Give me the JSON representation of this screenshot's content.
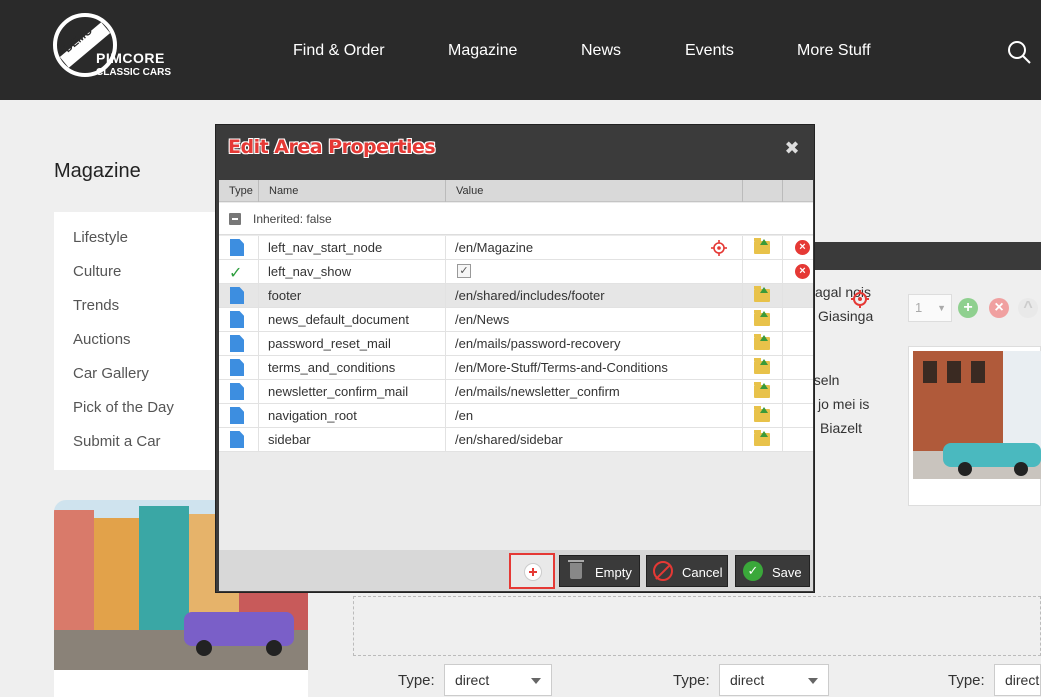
{
  "nav": {
    "logo_demo": "DEMO",
    "logo_brand": "PIMCORE",
    "logo_sub": "CLASSIC CARS",
    "items": [
      "Find & Order",
      "Magazine",
      "News",
      "Events",
      "More Stuff"
    ]
  },
  "page": {
    "title": "Magazine",
    "sidebar": [
      "Lifestyle",
      "Culture",
      "Trends",
      "Auctions",
      "Car Gallery",
      "Pick of the Day",
      "Submit a Car"
    ],
    "bg_text": [
      "agal nois",
      "Giasinga",
      "eseln",
      "jo mei is",
      "Biazelt"
    ],
    "select_value": "1",
    "type_label": "Type:",
    "type_value": "direct"
  },
  "dialog": {
    "title": "Edit Area Properties",
    "columns": {
      "type": "Type",
      "name": "Name",
      "value": "Value"
    },
    "group_label": "Inherited: false",
    "rows": [
      {
        "name": "left_nav_start_node",
        "value": "/en/Magazine"
      },
      {
        "name": "left_nav_show",
        "value": ""
      },
      {
        "name": "footer",
        "value": "/en/shared/includes/footer"
      },
      {
        "name": "news_default_document",
        "value": "/en/News"
      },
      {
        "name": "password_reset_mail",
        "value": "/en/mails/password-recovery"
      },
      {
        "name": "terms_and_conditions",
        "value": "/en/More-Stuff/Terms-and-Conditions"
      },
      {
        "name": "newsletter_confirm_mail",
        "value": "/en/mails/newsletter_confirm"
      },
      {
        "name": "navigation_root",
        "value": "/en"
      },
      {
        "name": "sidebar",
        "value": "/en/shared/sidebar"
      }
    ],
    "buttons": {
      "empty": "Empty",
      "cancel": "Cancel",
      "save": "Save"
    }
  },
  "colors": {
    "accent": "#e53935",
    "nav_bg": "#2a2a2a",
    "dialog_bg": "#3b3b3b"
  }
}
